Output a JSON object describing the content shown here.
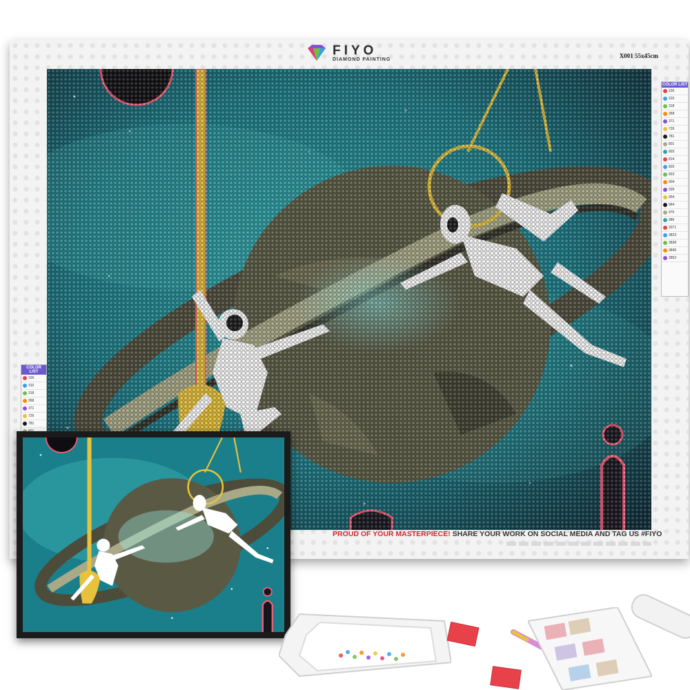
{
  "brand": {
    "name": "FIYO",
    "subtitle": "DIAMOND PAINTING"
  },
  "size_code": "X001 55x45cm",
  "color_list_title": "COLOR LIST",
  "color_list_codes": [
    "156",
    "310",
    "318",
    "368",
    "371",
    "726",
    "781",
    "801",
    "803",
    "814",
    "820",
    "823",
    "904",
    "939",
    "954",
    "964",
    "975",
    "986",
    "3371",
    "3823",
    "3838",
    "3846",
    "3852"
  ],
  "footer": {
    "highlight": "PROUD OF YOUR MASTERPIECE!",
    "rest": "SHARE YOUR WORK ON SOCIAL MEDIA AND TAG US #FIYO"
  },
  "colors": {
    "space_teal": "#1f8f96",
    "space_dark": "#0d2f3a",
    "planet": "#5a5a44",
    "ring": "#a9a988",
    "rope": "#e8c23a",
    "neon": "#ff5d7a",
    "accent_red": "#d7262e"
  }
}
